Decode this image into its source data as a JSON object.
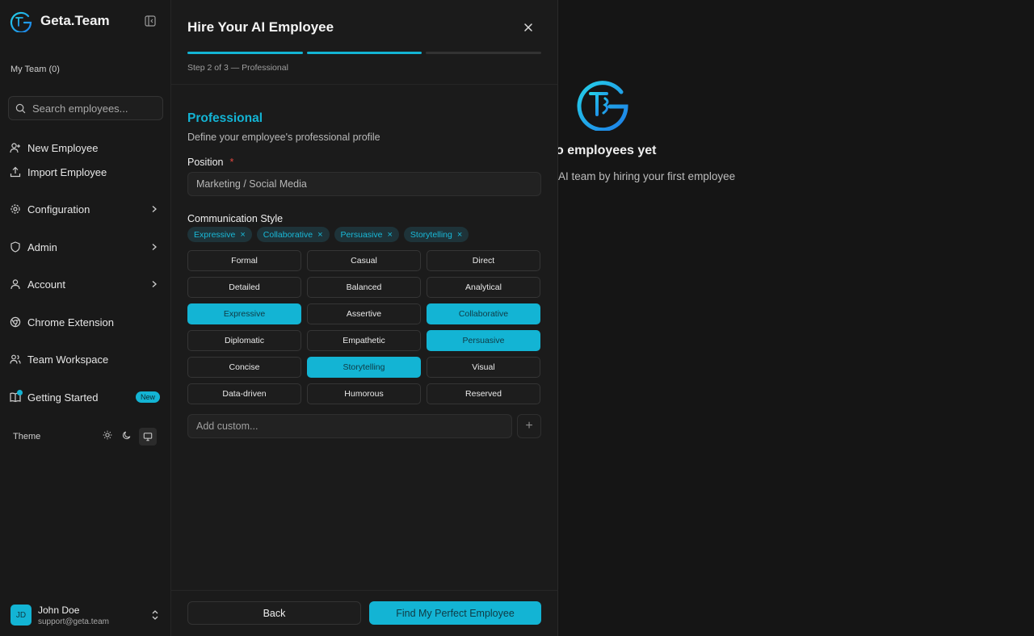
{
  "colors": {
    "accent": "#13b4d4",
    "background": "#151515",
    "sidebar": "#191919",
    "modal": "#1b1b1b"
  },
  "sidebar": {
    "brand_name": "Geta.Team",
    "team_label": "My Team (0)",
    "search_placeholder": "Search employees...",
    "items": {
      "new_employee": "New Employee",
      "import_employee": "Import Employee",
      "configuration": "Configuration",
      "admin": "Admin",
      "account": "Account",
      "chrome_extension": "Chrome Extension",
      "team_workspace": "Team Workspace",
      "getting_started": "Getting Started"
    },
    "new_badge": "New",
    "theme_label": "Theme",
    "user": {
      "initials": "JD",
      "name": "John Doe",
      "email": "support@geta.team"
    }
  },
  "empty_state": {
    "title": "o employees yet",
    "subtitle": "AI team by hiring your first employee"
  },
  "modal": {
    "title": "Hire Your AI Employee",
    "step_label": "Step 2 of 3 — Professional",
    "section_title": "Professional",
    "section_subtitle": "Define your employee's professional profile",
    "position_label": "Position",
    "required_mark": "*",
    "position_value": "Marketing / Social Media",
    "comm_label": "Communication Style",
    "selected_chips": [
      "Expressive",
      "Collaborative",
      "Persuasive",
      "Storytelling"
    ],
    "chip_remove": "×",
    "options": [
      "Formal",
      "Casual",
      "Direct",
      "Detailed",
      "Balanced",
      "Analytical",
      "Expressive",
      "Assertive",
      "Collaborative",
      "Diplomatic",
      "Empathetic",
      "Persuasive",
      "Concise",
      "Storytelling",
      "Visual",
      "Data-driven",
      "Humorous",
      "Reserved"
    ],
    "custom_placeholder": "Add custom...",
    "add_symbol": "+",
    "back_label": "Back",
    "primary_label": "Find My Perfect Employee"
  }
}
